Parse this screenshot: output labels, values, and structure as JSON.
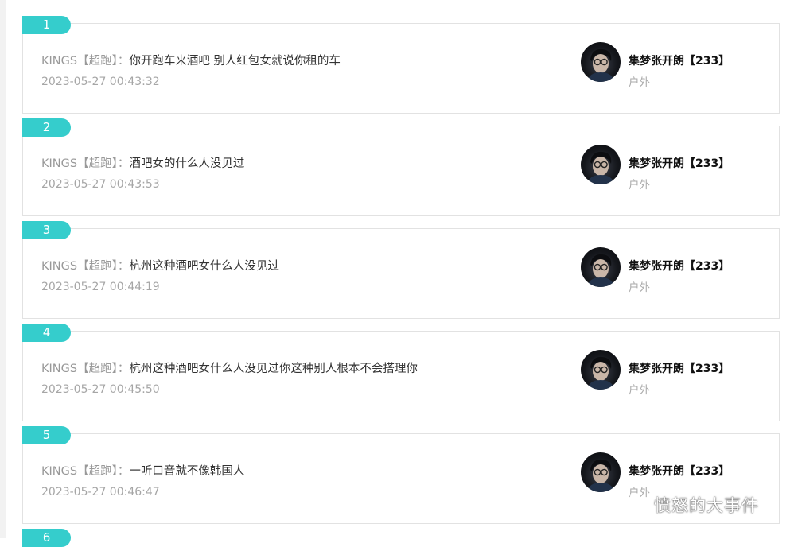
{
  "items": [
    {
      "index": "1",
      "user": "KINGS",
      "tag": "【超跑】",
      "sep": "：",
      "message": "你开跑车来酒吧 别人红包女就说你租的车",
      "time": "2023-05-27 00:43:32",
      "target": "集梦张开朗【233】",
      "room": "户外"
    },
    {
      "index": "2",
      "user": "KINGS",
      "tag": "【超跑】",
      "sep": "：",
      "message": "酒吧女的什么人没见过",
      "time": "2023-05-27 00:43:53",
      "target": "集梦张开朗【233】",
      "room": "户外"
    },
    {
      "index": "3",
      "user": "KINGS",
      "tag": "【超跑】",
      "sep": "：",
      "message": "杭州这种酒吧女什么人没见过",
      "time": "2023-05-27 00:44:19",
      "target": "集梦张开朗【233】",
      "room": "户外"
    },
    {
      "index": "4",
      "user": "KINGS",
      "tag": "【超跑】",
      "sep": "：",
      "message": "杭州这种酒吧女什么人没见过你这种别人根本不会搭理你",
      "time": "2023-05-27 00:45:50",
      "target": "集梦张开朗【233】",
      "room": "户外"
    },
    {
      "index": "5",
      "user": "KINGS",
      "tag": "【超跑】",
      "sep": "：",
      "message": "一听口音就不像韩国人",
      "time": "2023-05-27 00:46:47",
      "target": "集梦张开朗【233】",
      "room": "户外"
    }
  ],
  "next_index": "6",
  "watermark": "愤怒的大事件",
  "colors": {
    "accent": "#35cdcc",
    "border": "#e2e2e2",
    "muted": "#999999",
    "text": "#333333"
  }
}
